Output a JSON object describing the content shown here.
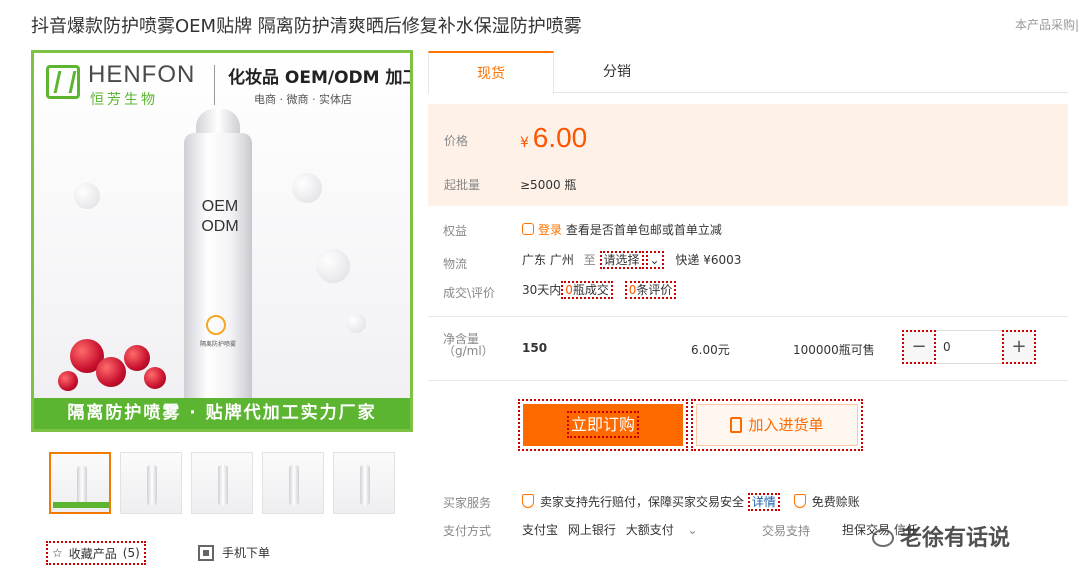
{
  "product": {
    "title": "抖音爆款防护喷雾OEM贴牌 隔离防护清爽晒后修复补水保湿防护喷雾",
    "top_right_text": "本产品采购|"
  },
  "image": {
    "brand_name": "HENFON",
    "brand_sub": "恒芳生物",
    "brand_right_title": "化妆品 OEM/ODM 加工",
    "brand_right_sub": "电商 · 微商 · 实体店",
    "bottle_text_1": "OEM",
    "bottle_text_2": "ODM",
    "bottle_label": "隔离防护喷雾",
    "banner": "隔离防护喷雾 · 贴牌代加工实力厂家"
  },
  "thumbnails": [
    "thumb-1",
    "thumb-2",
    "thumb-3",
    "thumb-4",
    "thumb-5"
  ],
  "actions": {
    "favorite_label": "收藏产品",
    "favorite_count": "(5)",
    "mobile_order": "手机下单"
  },
  "tabs": [
    {
      "label": "现货"
    },
    {
      "label": "分销"
    }
  ],
  "price": {
    "label": "价格",
    "currency": "¥",
    "value": "6.00",
    "moq_label": "起批量",
    "moq_value": "≥5000 瓶"
  },
  "rights": {
    "label": "权益",
    "login": "登录",
    "text": "查看是否首单包邮或首单立减"
  },
  "logistics": {
    "label": "物流",
    "origin": "广东 广州",
    "to": "至",
    "select": "请选择",
    "express": "快递 ¥6003"
  },
  "deals": {
    "label": "成交\\评价",
    "days": "30天内",
    "sold_count": "0",
    "sold_unit": "瓶成交",
    "review_count": "0",
    "review_unit": "条评价"
  },
  "spec": {
    "label_1": "净含量",
    "label_2": "（g/ml）",
    "value": "150",
    "price": "6.00元",
    "stock": "100000瓶可售",
    "qty": "0",
    "minus": "−",
    "plus": "+"
  },
  "buttons": {
    "order": "立即订购",
    "cart": "加入进货单"
  },
  "service": {
    "buyer_label": "买家服务",
    "buyer_text": "卖家支持先行赔付，保障买家交易安全",
    "detail": "详情",
    "free_pay": "免费赊账",
    "pay_label": "支付方式",
    "pay_1": "支付宝",
    "pay_2": "网上银行",
    "pay_3": "大额支付",
    "trade_label": "交易支持",
    "trade_text": "担保交易 信任"
  },
  "watermark": "老徐有话说"
}
